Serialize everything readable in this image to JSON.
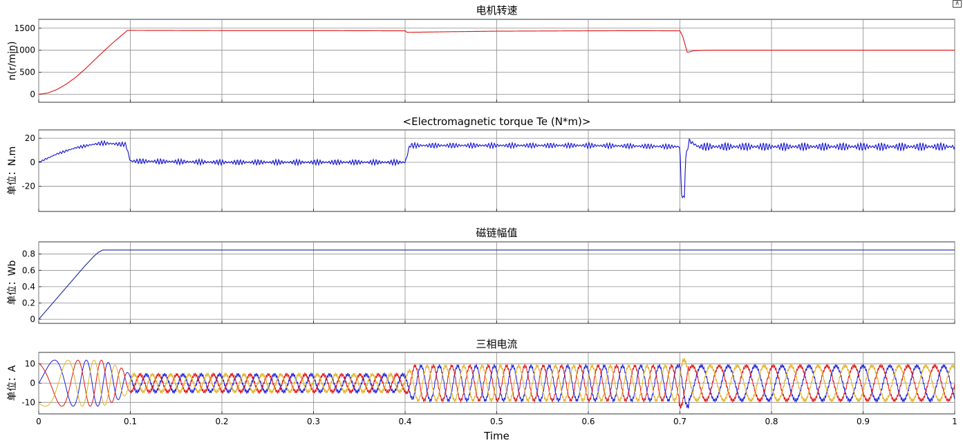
{
  "toolbar": {
    "pin_icon": "restore-icon",
    "pin_glyph": "⊼"
  },
  "x_axis": {
    "label": "Time",
    "range": [
      0,
      1
    ],
    "ticks": [
      0,
      0.1,
      0.2,
      0.3,
      0.4,
      0.5,
      0.6,
      0.7,
      0.8,
      0.9,
      1
    ],
    "tick_labels": [
      "0",
      "0.1",
      "0.2",
      "0.3",
      "0.4",
      "0.5",
      "0.6",
      "0.7",
      "0.8",
      "0.9",
      "1"
    ]
  },
  "chart_data": [
    {
      "type": "line",
      "title": "电机转速",
      "ylabel": "n(r/min)",
      "ylim": [
        -180,
        1700
      ],
      "yticks": [
        0,
        500,
        1000,
        1500
      ],
      "ytick_labels": [
        "0",
        "500",
        "1000",
        "1500"
      ],
      "grid": true,
      "series": [
        {
          "color": "#e01010",
          "x": [
            0,
            0.01,
            0.02,
            0.03,
            0.04,
            0.05,
            0.06,
            0.07,
            0.08,
            0.09,
            0.097,
            0.2,
            0.3,
            0.4,
            0.402,
            0.45,
            0.5,
            0.55,
            0.6,
            0.65,
            0.7,
            0.703,
            0.708,
            0.715,
            0.73,
            0.8,
            0.9,
            1.0
          ],
          "y": [
            0,
            30,
            110,
            230,
            380,
            560,
            760,
            960,
            1150,
            1330,
            1450,
            1445,
            1445,
            1440,
            1405,
            1420,
            1432,
            1436,
            1440,
            1443,
            1440,
            1320,
            950,
            990,
            1000,
            1000,
            1000,
            1000
          ]
        }
      ]
    },
    {
      "type": "line",
      "title": "<Electromagnetic torque Te (N*m)>",
      "ylabel": "单位：N.m",
      "ylim": [
        -41,
        27
      ],
      "yticks": [
        -20,
        0,
        20
      ],
      "ytick_labels": [
        "-20",
        "0",
        "20"
      ],
      "grid": true,
      "series": [
        {
          "color": "#1010d0",
          "x": [
            0,
            0.02,
            0.04,
            0.06,
            0.07,
            0.09,
            0.095,
            0.1,
            0.2,
            0.3,
            0.4,
            0.402,
            0.405,
            0.5,
            0.6,
            0.7,
            0.701,
            0.702,
            0.703,
            0.705,
            0.706,
            0.71,
            0.72,
            0.8,
            0.9,
            1.0
          ],
          "y": [
            0,
            7,
            12,
            15,
            16,
            15,
            15,
            1,
            0,
            0,
            0,
            5,
            14,
            14,
            14,
            13,
            -10,
            -29,
            -29,
            -29,
            2,
            18,
            13,
            13,
            13,
            13
          ],
          "ripple": [
            0.5,
            1,
            1.2,
            1.5,
            2,
            2,
            2,
            2.4,
            2.4,
            2.4,
            2.4,
            2,
            2.3,
            2.3,
            2.3,
            2.3,
            0,
            0.5,
            1,
            1,
            2,
            2,
            3.5,
            3.5,
            3.5,
            3.5
          ]
        }
      ]
    },
    {
      "type": "line",
      "title": "磁链幅值",
      "ylabel": "单位：Wb",
      "ylim": [
        -0.05,
        0.95
      ],
      "yticks": [
        0,
        0.2,
        0.4,
        0.6,
        0.8
      ],
      "ytick_labels": [
        "0",
        "0.2",
        "0.4",
        "0.6",
        "0.8"
      ],
      "grid": true,
      "series": [
        {
          "color": "#1828a0",
          "x": [
            0,
            0.01,
            0.02,
            0.03,
            0.04,
            0.05,
            0.06,
            0.065,
            0.07,
            0.1,
            0.4,
            0.7,
            1.0
          ],
          "y": [
            0,
            0.13,
            0.26,
            0.39,
            0.52,
            0.65,
            0.77,
            0.82,
            0.85,
            0.85,
            0.85,
            0.85,
            0.85
          ]
        }
      ]
    },
    {
      "type": "line",
      "title": "三相电流",
      "ylabel": "单位：A",
      "ylim": [
        -16,
        16
      ],
      "yticks": [
        -10,
        0,
        10
      ],
      "ytick_labels": [
        "-10",
        "0",
        "10"
      ],
      "grid": true,
      "series": [
        {
          "color": "#1a1ad8",
          "phase_deg": 0
        },
        {
          "color": "#e01010",
          "phase_deg": 120
        },
        {
          "color": "#e0b020",
          "phase_deg": 240
        }
      ],
      "envelope": {
        "t": [
          0,
          0.07,
          0.09,
          0.1,
          0.4,
          0.41,
          0.7,
          0.71,
          1.0
        ],
        "amplitude": [
          12,
          12,
          8,
          4.5,
          4.5,
          9,
          9,
          9,
          9
        ]
      },
      "frequency_hz": {
        "t": [
          0,
          0.02,
          0.05,
          0.1,
          0.4,
          0.7,
          0.71,
          1.0
        ],
        "f": [
          10,
          20,
          38,
          50,
          50,
          50,
          34,
          34
        ]
      }
    }
  ]
}
